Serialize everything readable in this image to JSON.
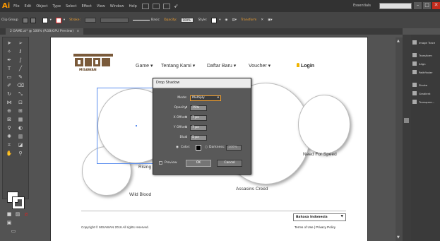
{
  "app": {
    "logo": "Ai",
    "menu": [
      "File",
      "Edit",
      "Object",
      "Type",
      "Select",
      "Effect",
      "View",
      "Window",
      "Help"
    ],
    "workspace": "Essentials",
    "window_controls": [
      "–",
      "□",
      "✕"
    ]
  },
  "control_bar": {
    "selection_label": "Clip Group",
    "stroke_label": "Stroke:",
    "brush_label": "Basic",
    "opacity_label": "Opacity:",
    "opacity_value": "100%",
    "style_label": "Style:",
    "transform_label": "Transform",
    "accent_color": "#f0a030"
  },
  "document": {
    "tab_title": "2 GAME.ai* @ 100% (RGB/GPU Preview)",
    "tab_close": "×"
  },
  "site": {
    "logo_text": "MISAWAN",
    "nav": [
      "Game ▾",
      "Tentang Kami ▾",
      "Daftar Baru ▾",
      "Voucher ▾"
    ],
    "login": "Login",
    "circles": {
      "c1": "Rising",
      "c2": "Wild Blood",
      "c3": "Assasins Creed",
      "c4": "Need For Speed"
    },
    "copyright": "Copyright © MISAWAN 2016 All rights reserved.",
    "language": "Bahasa Indonesia",
    "terms": "Terms of Use | Privacy Policy"
  },
  "drop_shadow_dialog": {
    "title": "Drop Shadow",
    "mode_label": "Mode:",
    "mode_value": "Multiply",
    "opacity_label": "Opacity:",
    "opacity_value": "75%",
    "xoffset_label": "X Offset:",
    "xoffset_value": "7 px",
    "yoffset_label": "Y Offset:",
    "yoffset_value": "7 px",
    "blur_label": "Blur:",
    "blur_value": "5 px",
    "color_label": "Color:",
    "darkness_label": "Darkness:",
    "darkness_value": "100%",
    "preview_label": "Preview",
    "ok_label": "OK",
    "cancel_label": "Cancel"
  },
  "panels": [
    "Image Trace",
    "Transform",
    "Align",
    "Pathfinder",
    "Stroke",
    "Gradient",
    "Transpare..."
  ]
}
